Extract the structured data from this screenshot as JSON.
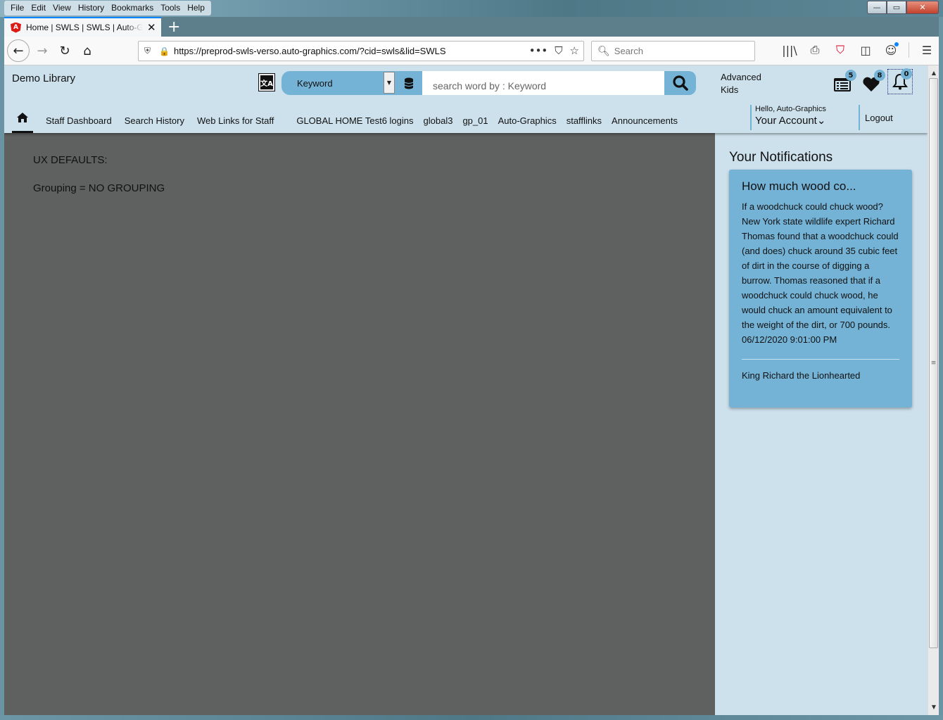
{
  "window": {
    "menu": [
      "File",
      "Edit",
      "View",
      "History",
      "Bookmarks",
      "Tools",
      "Help"
    ],
    "controls": {
      "minimize": "—",
      "maximize": "▭",
      "close": "✕"
    }
  },
  "tab": {
    "title": "Home | SWLS | SWLS | Auto-Graphics",
    "favicon": "A",
    "close": "✕",
    "new_tab": "+"
  },
  "browser": {
    "url": "https://preprod-swls-verso.auto-graphics.com/?cid=swls&lid=SWLS",
    "search_placeholder": "Search",
    "icons": {
      "back": "←",
      "forward": "→",
      "reload": "↻",
      "home": "⌂",
      "page_actions": "•••",
      "pocket": "⛉",
      "bookmark": "☆",
      "library": "|||\\",
      "print": "⎙",
      "sidebar": "◫",
      "account": "☺",
      "menu": "☰"
    }
  },
  "header": {
    "library_name": "Demo Library",
    "search_type": "Keyword",
    "search_placeholder": "search word by : Keyword",
    "advanced_label": "Advanced",
    "kids_label": "Kids",
    "badges": {
      "list": "5",
      "favorites": "8",
      "notifications": "0"
    }
  },
  "nav": {
    "links": [
      "Staff Dashboard",
      "Search History",
      "Web Links for Staff",
      "GLOBAL HOME Test6 logins",
      "global3",
      "gp_01",
      "Auto-Graphics",
      "stafflinks",
      "Announcements"
    ],
    "greeting": "Hello, Auto-Graphics",
    "account_label": "Your Account",
    "account_chevron": "⌄",
    "logout_label": "Logout"
  },
  "content": {
    "ux_defaults_label": "UX DEFAULTS:",
    "grouping_line": "Grouping = NO GROUPING"
  },
  "notifications": {
    "title": "Your Notifications",
    "items": [
      {
        "heading": "How much wood co...",
        "body": "If a woodchuck could chuck wood? New York state wildlife expert Richard Thomas found that a woodchuck could (and does) chuck around 35 cubic feet of dirt in the course of digging a burrow. Thomas reasoned that if a woodchuck could chuck wood, he would chuck an amount equivalent to the weight of the dirt, or 700 pounds.",
        "date": "06/12/2020 9:01:00 PM",
        "from": "King Richard the Lionhearted"
      }
    ]
  },
  "colors": {
    "header_bg": "#cde1ec",
    "accent": "#74b3d6",
    "content_bg": "#5f6161"
  }
}
